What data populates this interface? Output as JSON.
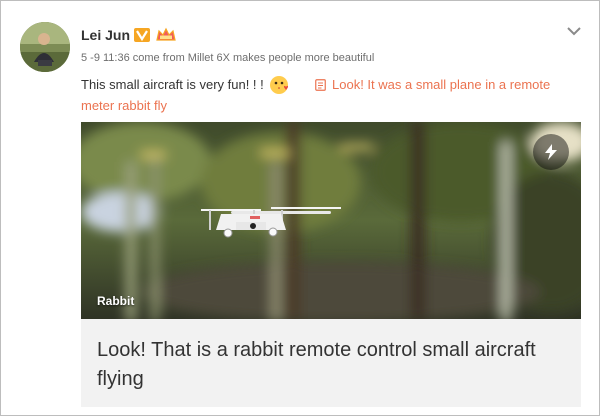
{
  "user": {
    "name": "Lei Jun",
    "avatar_icon": "user-avatar",
    "badges": [
      "verified-v-icon",
      "vip-crown-icon"
    ]
  },
  "post": {
    "meta": "5 -9 11:36 come from Millet 6X makes people more beautiful",
    "text": "This small aircraft is very fun! ! !",
    "emoji_icon": "kiss-emoji-icon",
    "link_icon": "document-icon",
    "link_text": "Look! It was a small plane in a remote meter rabbit fly"
  },
  "card": {
    "caption": "Rabbit",
    "title": "Look! That is a rabbit remote control small aircraft flying",
    "action_icon": "lightning-icon"
  },
  "menu_icon": "chevron-down-icon",
  "colors": {
    "link": "#eb7350",
    "badge": "#f6a623",
    "crown": "#f25a5a"
  }
}
